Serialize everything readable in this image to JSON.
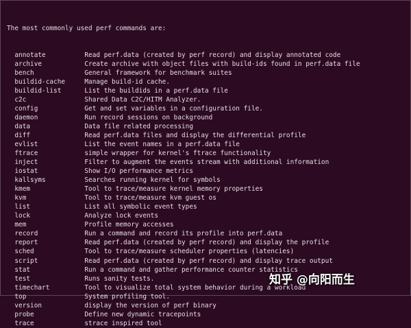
{
  "terminal": {
    "heading": "The most commonly used perf commands are:",
    "commands": [
      {
        "name": "annotate",
        "desc": "Read perf.data (created by perf record) and display annotated code"
      },
      {
        "name": "archive",
        "desc": "Create archive with object files with build-ids found in perf.data file"
      },
      {
        "name": "bench",
        "desc": "General framework for benchmark suites"
      },
      {
        "name": "buildid-cache",
        "desc": "Manage build-id cache."
      },
      {
        "name": "buildid-list",
        "desc": "List the buildids in a perf.data file"
      },
      {
        "name": "c2c",
        "desc": "Shared Data C2C/HITM Analyzer."
      },
      {
        "name": "config",
        "desc": "Get and set variables in a configuration file."
      },
      {
        "name": "daemon",
        "desc": "Run record sessions on background"
      },
      {
        "name": "data",
        "desc": "Data file related processing"
      },
      {
        "name": "diff",
        "desc": "Read perf.data files and display the differential profile"
      },
      {
        "name": "evlist",
        "desc": "List the event names in a perf.data file"
      },
      {
        "name": "ftrace",
        "desc": "simple wrapper for kernel's ftrace functionality"
      },
      {
        "name": "inject",
        "desc": "Filter to augment the events stream with additional information"
      },
      {
        "name": "iostat",
        "desc": "Show I/O performance metrics"
      },
      {
        "name": "kallsyms",
        "desc": "Searches running kernel for symbols"
      },
      {
        "name": "kmem",
        "desc": "Tool to trace/measure kernel memory properties"
      },
      {
        "name": "kvm",
        "desc": "Tool to trace/measure kvm guest os"
      },
      {
        "name": "list",
        "desc": "List all symbolic event types"
      },
      {
        "name": "lock",
        "desc": "Analyze lock events"
      },
      {
        "name": "mem",
        "desc": "Profile memory accesses"
      },
      {
        "name": "record",
        "desc": "Run a command and record its profile into perf.data"
      },
      {
        "name": "report",
        "desc": "Read perf.data (created by perf record) and display the profile"
      },
      {
        "name": "sched",
        "desc": "Tool to trace/measure scheduler properties (latencies)"
      },
      {
        "name": "script",
        "desc": "Read perf.data (created by perf record) and display trace output"
      },
      {
        "name": "stat",
        "desc": "Run a command and gather performance counter statistics"
      },
      {
        "name": "test",
        "desc": "Runs sanity tests."
      },
      {
        "name": "timechart",
        "desc": "Tool to visualize total system behavior during a workload"
      },
      {
        "name": "top",
        "desc": "System profiling tool."
      },
      {
        "name": "version",
        "desc": "display the version of perf binary"
      },
      {
        "name": "probe",
        "desc": "Define new dynamic tracepoints"
      },
      {
        "name": "trace",
        "desc": "strace inspired tool"
      }
    ]
  },
  "watermark": "知乎 @向阳而生",
  "colors": {
    "background": "#2c0a22",
    "text": "#e4dfe0"
  }
}
